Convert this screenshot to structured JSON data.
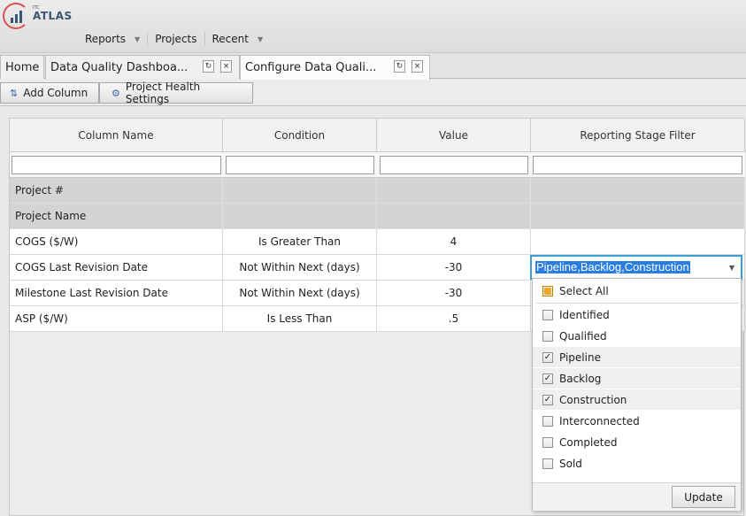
{
  "app": {
    "logo_small": "ITC",
    "logo_text": "ATLAS"
  },
  "nav": {
    "reports": "Reports",
    "projects": "Projects",
    "recent": "Recent"
  },
  "tabs": {
    "home": "Home",
    "dashboard": "Data Quality Dashboa...",
    "configure": "Configure Data Quali...",
    "refresh_glyph": "↻",
    "close_glyph": "×"
  },
  "toolbar": {
    "add_column": "Add Column",
    "project_health": "Project Health Settings"
  },
  "grid": {
    "headers": {
      "column_name": "Column Name",
      "condition": "Condition",
      "value": "Value",
      "reporting_stage_filter": "Reporting Stage Filter"
    },
    "rows": [
      {
        "column_name": "Project #",
        "condition": "",
        "value": "",
        "filter": ""
      },
      {
        "column_name": "Project Name",
        "condition": "",
        "value": "",
        "filter": ""
      },
      {
        "column_name": "COGS ($/W)",
        "condition": "Is Greater Than",
        "value": "4",
        "filter": ""
      },
      {
        "column_name": "COGS Last Revision Date",
        "condition": "Not Within Next (days)",
        "value": "-30",
        "filter": ""
      },
      {
        "column_name": "Milestone Last Revision Date",
        "condition": "Not Within Next (days)",
        "value": "-30",
        "filter": ""
      },
      {
        "column_name": "ASP ($/W)",
        "condition": "Is Less Than",
        "value": ".5",
        "filter": ""
      }
    ]
  },
  "editor": {
    "value": "Pipeline,Backlog,Construction"
  },
  "dropdown": {
    "select_all": "Select All",
    "options": [
      {
        "label": "Identified",
        "checked": false
      },
      {
        "label": "Qualified",
        "checked": false
      },
      {
        "label": "Pipeline",
        "checked": true
      },
      {
        "label": "Backlog",
        "checked": true
      },
      {
        "label": "Construction",
        "checked": true
      },
      {
        "label": "Interconnected",
        "checked": false
      },
      {
        "label": "Completed",
        "checked": false
      },
      {
        "label": "Sold",
        "checked": false
      }
    ],
    "update_label": "Update",
    "check_glyph": "✓"
  },
  "colors": {
    "selection": "#2a7de1",
    "editor_border": "#3a9fd6",
    "partial_check": "#f5a623"
  }
}
